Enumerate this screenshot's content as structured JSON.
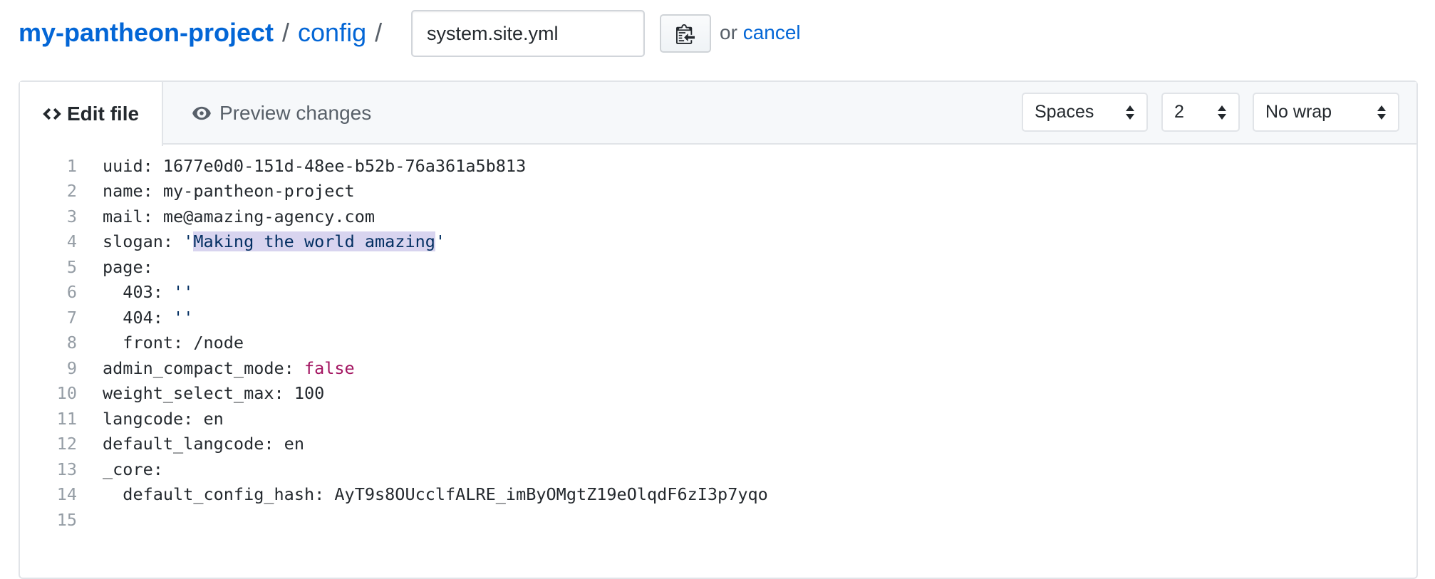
{
  "breadcrumb": {
    "repo": "my-pantheon-project",
    "folder": "config",
    "separator": "/"
  },
  "filename": {
    "value": "system.site.yml"
  },
  "clipboard_button": {
    "icon": "clipboard-icon"
  },
  "cancel": {
    "prefix": "or",
    "link": "cancel"
  },
  "tabs": [
    {
      "label": "Edit file",
      "icon": "code-icon",
      "active": true
    },
    {
      "label": "Preview changes",
      "icon": "eye-icon",
      "active": false
    }
  ],
  "selects": {
    "indent_mode": "Spaces",
    "indent_size": "2",
    "wrap_mode": "No wrap"
  },
  "code": {
    "line_numbers": [
      "1",
      "2",
      "3",
      "4",
      "5",
      "6",
      "7",
      "8",
      "9",
      "10",
      "11",
      "12",
      "13",
      "14",
      "15"
    ],
    "l1": "uuid: 1677e0d0-151d-48ee-b52b-76a361a5b813",
    "l2": "name: my-pantheon-project",
    "l3": "mail: me@amazing-agency.com",
    "l4_key": "slogan: ",
    "l4_q": "'",
    "l4_val": "Making the world amazing",
    "l5": "page:",
    "l6_key": "  403: ",
    "l6_val": "''",
    "l7_key": "  404: ",
    "l7_val": "''",
    "l8": "  front: /node",
    "l9_key": "admin_compact_mode: ",
    "l9_val": "false",
    "l10": "weight_select_max: 100",
    "l11": "langcode: en",
    "l12": "default_langcode: en",
    "l13": "_core:",
    "l14": "  default_config_hash: AyT9s8OUcclfALRE_imByOMgtZ19eOlqdF6zI3p7yqo",
    "l15": ""
  },
  "colors": {
    "link": "#0366d6",
    "string": "#032f62",
    "boolean": "#a31561",
    "selection": "#d8d4ef"
  }
}
